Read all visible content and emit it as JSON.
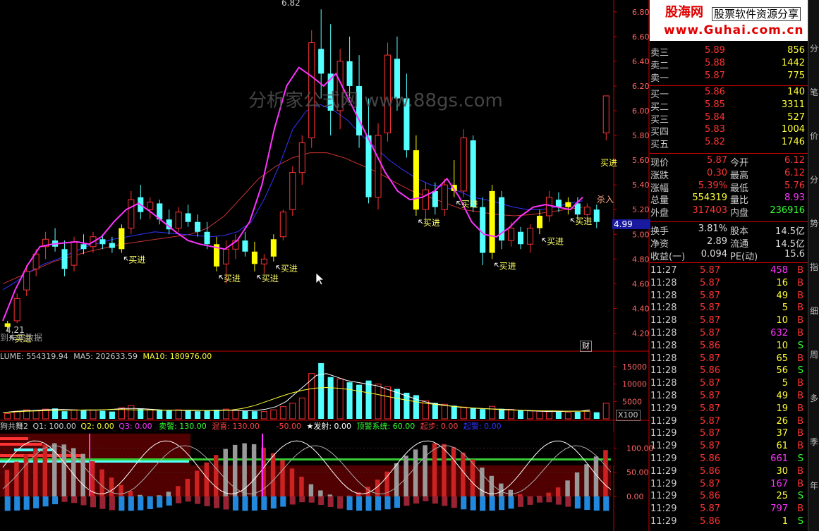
{
  "colors": {
    "up": "#ff3333",
    "down": "#54ffff",
    "ma_fast": "#ff33ff",
    "ma_mid": "#3333ff",
    "ma_slow": "#cc3333",
    "signal": "#ffff00",
    "grid": "#cc0000",
    "axis": "#ff6666"
  },
  "watermark": {
    "text": "分析家公式网 www.88gs.com"
  },
  "banner": {
    "logo": "股海网",
    "tagline": "股票软件资源分享",
    "url": "www.Guhai.com.cn"
  },
  "main_chart": {
    "high_label": "6.82",
    "low_label": "4.21",
    "future_label": "到未来数据",
    "finance_button": "财",
    "price_tag": "4.99",
    "sell_label": "杀入",
    "signal_label": "买进"
  },
  "volume_chart": {
    "header_label": "LUME:",
    "header_value": "554319.94",
    "ma5_label": "MA5:",
    "ma5_value": "202633.59",
    "ma10_label": "MA10:",
    "ma10_value": "180976.00",
    "multiplier": "X100"
  },
  "indicator_chart": {
    "name": "狗共舞2",
    "q1": "Q1: 100.00",
    "q2": "Q2: 0.00",
    "q3": "Q3: 0.00",
    "sell_warn": "卖警: 130.00",
    "v2": "混喜: 130.00",
    "v3": "-50.00",
    "v4": "★发射: 0.00",
    "v5": "顶警系统: 60.00",
    "v6": "起步: 0.00",
    "v7": "起警: 0.00"
  },
  "chart_data": [
    {
      "type": "candlestick",
      "title": "",
      "ylim": [
        4.1,
        6.85
      ],
      "yticks": [
        "6.80",
        "6.60",
        "6.40",
        "6.20",
        "6.00",
        "5.80",
        "5.60",
        "5.40",
        "5.20",
        "5.00",
        "4.80",
        "4.60",
        "4.40",
        "4.20"
      ],
      "candles": [
        {
          "o": 4.25,
          "h": 4.3,
          "l": 4.21,
          "c": 4.28
        },
        {
          "o": 4.3,
          "h": 4.52,
          "l": 4.28,
          "c": 4.48
        },
        {
          "o": 4.55,
          "h": 4.75,
          "l": 4.5,
          "c": 4.7
        },
        {
          "o": 4.72,
          "h": 4.88,
          "l": 4.66,
          "c": 4.84
        },
        {
          "o": 4.9,
          "h": 5.02,
          "l": 4.8,
          "c": 4.96
        },
        {
          "o": 4.95,
          "h": 5.05,
          "l": 4.86,
          "c": 4.9
        },
        {
          "o": 4.88,
          "h": 4.95,
          "l": 4.66,
          "c": 4.72
        },
        {
          "o": 4.75,
          "h": 4.98,
          "l": 4.7,
          "c": 4.94
        },
        {
          "o": 4.92,
          "h": 5.0,
          "l": 4.84,
          "c": 4.88
        },
        {
          "o": 4.9,
          "h": 5.02,
          "l": 4.85,
          "c": 4.98
        },
        {
          "o": 4.96,
          "h": 5.0,
          "l": 4.88,
          "c": 4.92
        },
        {
          "o": 4.93,
          "h": 4.98,
          "l": 4.85,
          "c": 4.89
        },
        {
          "o": 4.88,
          "h": 5.08,
          "l": 4.85,
          "c": 5.05
        },
        {
          "o": 5.05,
          "h": 5.35,
          "l": 5.0,
          "c": 5.28
        },
        {
          "o": 5.3,
          "h": 5.4,
          "l": 5.12,
          "c": 5.18
        },
        {
          "o": 5.2,
          "h": 5.3,
          "l": 5.12,
          "c": 5.26
        },
        {
          "o": 5.25,
          "h": 5.28,
          "l": 5.08,
          "c": 5.12
        },
        {
          "o": 5.12,
          "h": 5.2,
          "l": 5.0,
          "c": 5.04
        },
        {
          "o": 5.05,
          "h": 5.22,
          "l": 5.02,
          "c": 5.18
        },
        {
          "o": 5.17,
          "h": 5.24,
          "l": 5.06,
          "c": 5.1
        },
        {
          "o": 5.1,
          "h": 5.16,
          "l": 4.98,
          "c": 5.02
        },
        {
          "o": 5.02,
          "h": 5.1,
          "l": 4.88,
          "c": 4.92
        },
        {
          "o": 4.92,
          "h": 4.98,
          "l": 4.7,
          "c": 4.74
        },
        {
          "o": 4.76,
          "h": 4.95,
          "l": 4.6,
          "c": 4.88
        },
        {
          "o": 4.88,
          "h": 5.0,
          "l": 4.8,
          "c": 4.95
        },
        {
          "o": 4.95,
          "h": 5.02,
          "l": 4.82,
          "c": 4.86
        },
        {
          "o": 4.86,
          "h": 4.94,
          "l": 4.7,
          "c": 4.76
        },
        {
          "o": 4.76,
          "h": 4.84,
          "l": 4.68,
          "c": 4.8
        },
        {
          "o": 4.82,
          "h": 5.0,
          "l": 4.78,
          "c": 4.96
        },
        {
          "o": 4.98,
          "h": 5.2,
          "l": 4.95,
          "c": 5.18
        },
        {
          "o": 5.2,
          "h": 5.55,
          "l": 5.15,
          "c": 5.5
        },
        {
          "o": 5.5,
          "h": 5.8,
          "l": 5.4,
          "c": 5.74
        },
        {
          "o": 5.78,
          "h": 6.65,
          "l": 5.7,
          "c": 6.55
        },
        {
          "o": 6.5,
          "h": 6.82,
          "l": 6.1,
          "c": 6.3
        },
        {
          "o": 6.3,
          "h": 6.7,
          "l": 5.8,
          "c": 6.0
        },
        {
          "o": 6.0,
          "h": 6.5,
          "l": 5.85,
          "c": 6.4
        },
        {
          "o": 6.4,
          "h": 6.6,
          "l": 6.1,
          "c": 6.2
        },
        {
          "o": 6.2,
          "h": 6.45,
          "l": 5.7,
          "c": 5.8
        },
        {
          "o": 5.8,
          "h": 6.1,
          "l": 5.25,
          "c": 5.3
        },
        {
          "o": 5.3,
          "h": 5.9,
          "l": 5.2,
          "c": 5.8
        },
        {
          "o": 5.82,
          "h": 6.55,
          "l": 5.75,
          "c": 6.45
        },
        {
          "o": 6.42,
          "h": 6.6,
          "l": 6.0,
          "c": 6.1
        },
        {
          "o": 6.1,
          "h": 6.3,
          "l": 5.62,
          "c": 5.68
        },
        {
          "o": 5.68,
          "h": 5.8,
          "l": 5.15,
          "c": 5.2
        },
        {
          "o": 5.2,
          "h": 5.42,
          "l": 5.08,
          "c": 5.36
        },
        {
          "o": 5.35,
          "h": 5.42,
          "l": 5.16,
          "c": 5.22
        },
        {
          "o": 5.2,
          "h": 5.45,
          "l": 5.15,
          "c": 5.4
        },
        {
          "o": 5.4,
          "h": 5.6,
          "l": 5.3,
          "c": 5.35
        },
        {
          "o": 5.35,
          "h": 5.85,
          "l": 5.3,
          "c": 5.78
        },
        {
          "o": 5.76,
          "h": 5.8,
          "l": 5.18,
          "c": 5.22
        },
        {
          "o": 5.22,
          "h": 5.3,
          "l": 4.75,
          "c": 4.85
        },
        {
          "o": 4.85,
          "h": 5.4,
          "l": 4.8,
          "c": 5.35
        },
        {
          "o": 5.3,
          "h": 5.35,
          "l": 4.88,
          "c": 4.95
        },
        {
          "o": 4.95,
          "h": 5.1,
          "l": 4.9,
          "c": 5.05
        },
        {
          "o": 5.02,
          "h": 5.06,
          "l": 4.88,
          "c": 4.92
        },
        {
          "o": 4.92,
          "h": 5.08,
          "l": 4.85,
          "c": 5.05
        },
        {
          "o": 5.05,
          "h": 5.2,
          "l": 5.0,
          "c": 5.15
        },
        {
          "o": 5.15,
          "h": 5.35,
          "l": 5.1,
          "c": 5.3
        },
        {
          "o": 5.28,
          "h": 5.34,
          "l": 5.18,
          "c": 5.22
        },
        {
          "o": 5.22,
          "h": 5.3,
          "l": 5.16,
          "c": 5.26
        },
        {
          "o": 5.25,
          "h": 5.3,
          "l": 5.12,
          "c": 5.16
        },
        {
          "o": 5.16,
          "h": 5.25,
          "l": 5.1,
          "c": 5.22
        },
        {
          "o": 5.2,
          "h": 5.24,
          "l": 5.05,
          "c": 5.1
        },
        {
          "o": 5.82,
          "h": 6.12,
          "l": 5.76,
          "c": 6.12
        }
      ],
      "ma_fast": [
        4.3,
        4.55,
        4.75,
        4.9,
        4.92,
        4.93,
        4.94,
        4.92,
        4.98,
        5.1,
        5.2,
        5.25,
        5.18,
        5.1,
        5.02,
        4.95,
        4.92,
        4.9,
        4.88,
        4.95,
        5.1,
        5.4,
        5.85,
        6.2,
        6.35,
        6.28,
        6.2,
        6.3,
        6.1,
        5.9,
        5.7,
        5.5,
        5.35,
        5.28,
        5.3,
        5.35,
        5.45,
        5.3,
        5.1,
        5.0,
        4.98,
        5.05,
        5.15,
        5.22,
        5.24,
        5.22,
        5.2,
        5.3
      ],
      "ma_mid": [
        4.55,
        4.62,
        4.7,
        4.76,
        4.8,
        4.85,
        4.9,
        4.93,
        4.96,
        4.98,
        5.0,
        5.02,
        5.01,
        5.0,
        4.99,
        4.98,
        4.99,
        5.02,
        5.1,
        5.3,
        5.55,
        5.85,
        6.0,
        6.05,
        6.0,
        5.92,
        5.8,
        5.7,
        5.6,
        5.52,
        5.45,
        5.4,
        5.38,
        5.35,
        5.3,
        5.28,
        5.25,
        5.22,
        5.2,
        5.2,
        5.22,
        5.25,
        5.27
      ],
      "ma_slow": [
        4.6,
        4.66,
        4.72,
        4.78,
        4.82,
        4.86,
        4.89,
        4.92,
        4.94,
        4.96,
        4.98,
        5.0,
        5.05,
        5.15,
        5.3,
        5.45,
        5.55,
        5.62,
        5.66,
        5.66,
        5.62,
        5.56,
        5.5,
        5.42,
        5.35,
        5.3,
        5.25,
        5.2,
        5.18,
        5.16,
        5.15,
        5.16,
        5.18,
        5.2,
        5.22
      ],
      "signals_at_candle": [
        0,
        12,
        22,
        26,
        28,
        43,
        47,
        51,
        56,
        59
      ]
    },
    {
      "type": "bar",
      "title": "VOLUME",
      "ylim": [
        0,
        17000
      ],
      "yticks": [
        "15000",
        "10000",
        "5000"
      ],
      "values": [
        1500,
        2200,
        2600,
        2400,
        2800,
        3000,
        2200,
        2600,
        2400,
        2500,
        2300,
        2100,
        3200,
        3800,
        3000,
        2700,
        2500,
        2400,
        2600,
        2300,
        2200,
        2400,
        2600,
        2800,
        2400,
        2300,
        2200,
        2100,
        2600,
        3500,
        4500,
        6000,
        13000,
        16000,
        12000,
        11500,
        10500,
        9800,
        11000,
        10000,
        9200,
        8600,
        7500,
        6800,
        5200,
        4600,
        4200,
        3800,
        3400,
        3200,
        2800,
        3600,
        2900,
        2700,
        2400,
        2300,
        2200,
        2100,
        2000,
        1900,
        2000,
        2200,
        1900,
        4500
      ],
      "ma5": [
        1800,
        2100,
        2300,
        2400,
        2600,
        2700,
        2700,
        2600,
        2500,
        2500,
        2600,
        2800,
        3000,
        3000,
        2900,
        2700,
        2500,
        2500,
        2400,
        2400,
        2400,
        2500,
        2500,
        2400,
        2300,
        2400,
        2800,
        3500,
        5000,
        7500,
        10000,
        12500,
        13000,
        12000,
        11000,
        10500,
        10000,
        9500,
        8500,
        7500,
        6500,
        5500,
        4700,
        4200,
        3800,
        3400,
        3200,
        3000,
        2900,
        2800,
        2700,
        2500,
        2300,
        2200,
        2100,
        2100,
        2200,
        2200,
        2600
      ],
      "ma10": [
        1800,
        2000,
        2200,
        2300,
        2400,
        2500,
        2500,
        2600,
        2600,
        2700,
        2700,
        2600,
        2600,
        2500,
        2500,
        2500,
        2500,
        2400,
        2400,
        2500,
        3000,
        3800,
        5000,
        6200,
        7300,
        8200,
        8800,
        9000,
        8800,
        8400,
        7800,
        7200,
        6500,
        5800,
        5200,
        4600,
        4200,
        3800,
        3500,
        3200,
        3000,
        2800,
        2600,
        2500,
        2400,
        2300,
        2300,
        2200,
        2200,
        2200
      ]
    },
    {
      "type": "bar",
      "title": "",
      "ylim": [
        -60,
        140
      ],
      "yticks": [
        "100.00",
        "50.00",
        "0.00"
      ]
    }
  ],
  "quote_panel": {
    "asks": [
      {
        "label": "卖五",
        "price": "",
        "vol": ""
      },
      {
        "label": "卖四",
        "price": "",
        "vol": ""
      },
      {
        "label": "卖三",
        "price": "5.89",
        "vol": "856"
      },
      {
        "label": "卖二",
        "price": "5.88",
        "vol": "1442"
      },
      {
        "label": "卖一",
        "price": "5.87",
        "vol": "775"
      }
    ],
    "bids": [
      {
        "label": "买一",
        "price": "5.86",
        "vol": "140"
      },
      {
        "label": "买二",
        "price": "5.85",
        "vol": "3311"
      },
      {
        "label": "买三",
        "price": "5.84",
        "vol": "527"
      },
      {
        "label": "买四",
        "price": "5.83",
        "vol": "1004"
      },
      {
        "label": "买五",
        "price": "5.82",
        "vol": "1746"
      }
    ],
    "stats": [
      {
        "l1": "现价",
        "v1": "5.87",
        "l2": "今开",
        "v2": "6.12"
      },
      {
        "l1": "涨跌",
        "v1": "0.30",
        "l2": "最高",
        "v2": "6.12"
      },
      {
        "l1": "涨幅",
        "v1": "5.39%",
        "l2": "最低",
        "v2": "5.76"
      },
      {
        "l1": "总量",
        "v1": "554319",
        "l2": "量比",
        "v2": "8.93"
      },
      {
        "l1": "外盘",
        "v1": "317403",
        "l2": "内盘",
        "v2": "236916"
      }
    ],
    "fin": [
      {
        "l1": "换手",
        "v1": "3.81%",
        "l2": "股本",
        "v2": "14.5亿"
      },
      {
        "l1": "净资",
        "v1": "2.89",
        "l2": "流通",
        "v2": "14.5亿"
      },
      {
        "l1": "收益(一)",
        "v1": "0.094",
        "l2": "PE(动)",
        "v2": "15.6"
      }
    ],
    "ticks": [
      {
        "t": "11:27",
        "p": "5.87",
        "v": "458",
        "d": "B"
      },
      {
        "t": "11:28",
        "p": "5.87",
        "v": "16",
        "d": "B"
      },
      {
        "t": "11:28",
        "p": "5.87",
        "v": "49",
        "d": "B"
      },
      {
        "t": "11:28",
        "p": "5.87",
        "v": "5",
        "d": "B"
      },
      {
        "t": "11:28",
        "p": "5.87",
        "v": "10",
        "d": "B"
      },
      {
        "t": "11:28",
        "p": "5.87",
        "v": "632",
        "d": "B"
      },
      {
        "t": "11:28",
        "p": "5.86",
        "v": "10",
        "d": "S"
      },
      {
        "t": "11:28",
        "p": "5.87",
        "v": "65",
        "d": "B"
      },
      {
        "t": "11:28",
        "p": "5.86",
        "v": "56",
        "d": "S"
      },
      {
        "t": "11:28",
        "p": "5.87",
        "v": "5",
        "d": "B"
      },
      {
        "t": "11:28",
        "p": "5.87",
        "v": "49",
        "d": "B"
      },
      {
        "t": "11:29",
        "p": "5.87",
        "v": "19",
        "d": "B"
      },
      {
        "t": "11:29",
        "p": "5.87",
        "v": "26",
        "d": "B"
      },
      {
        "t": "11:29",
        "p": "5.87",
        "v": "37",
        "d": "B"
      },
      {
        "t": "11:29",
        "p": "5.87",
        "v": "61",
        "d": "B"
      },
      {
        "t": "11:29",
        "p": "5.86",
        "v": "661",
        "d": "S"
      },
      {
        "t": "11:29",
        "p": "5.86",
        "v": "30",
        "d": "B"
      },
      {
        "t": "11:29",
        "p": "5.87",
        "v": "167",
        "d": "B"
      },
      {
        "t": "11:29",
        "p": "5.86",
        "v": "25",
        "d": "S"
      },
      {
        "t": "11:29",
        "p": "5.87",
        "v": "797",
        "d": "B"
      },
      {
        "t": "11:29",
        "p": "5.86",
        "v": "1",
        "d": "S"
      }
    ]
  },
  "sidebar": [
    "分",
    "笔",
    "价",
    "分",
    "势",
    "指",
    "细",
    "周",
    "多",
    "季",
    "年"
  ]
}
